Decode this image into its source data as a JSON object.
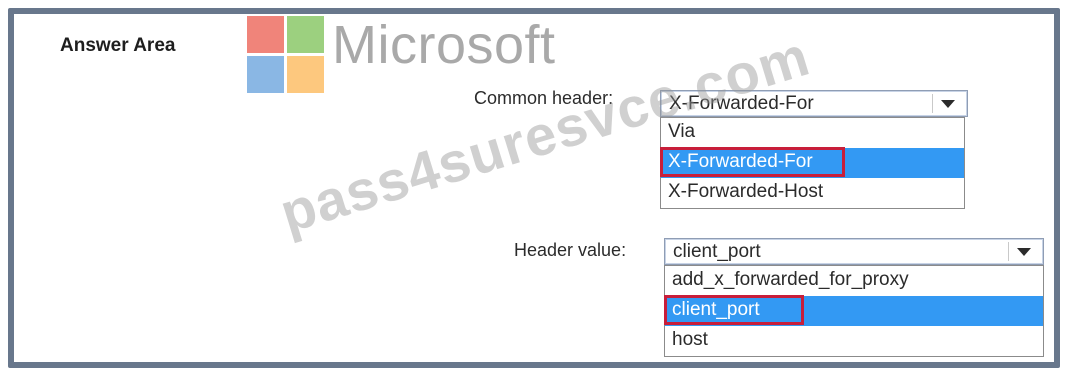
{
  "answer_area": {
    "title": "Answer Area"
  },
  "logo": {
    "word": "Microsoft"
  },
  "watermark": {
    "text": "pass4suresvce.com"
  },
  "common_header": {
    "label": "Common header:",
    "selected": "X-Forwarded-For",
    "options": [
      "Via",
      "X-Forwarded-For",
      "X-Forwarded-Host"
    ],
    "highlighted": "X-Forwarded-For"
  },
  "header_value": {
    "label": "Header value:",
    "selected": "client_port",
    "options": [
      "add_x_forwarded_for_proxy",
      "client_port",
      "host"
    ],
    "highlighted": "client_port"
  },
  "colors": {
    "frame": "#68778c",
    "selection": "#3399f3",
    "answer_box": "#c81e3a"
  }
}
